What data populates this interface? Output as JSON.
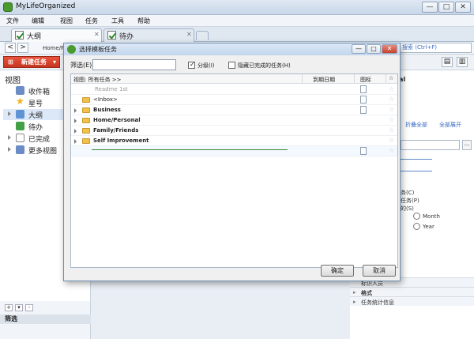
{
  "app": {
    "title": "MyLifeOrganized"
  },
  "window_buttons": {
    "minimize": "—",
    "maximize": "□",
    "close": "✕"
  },
  "menu": [
    "文件",
    "编辑",
    "视图",
    "任务",
    "工具",
    "帮助"
  ],
  "tabs": [
    {
      "label": "大纲"
    },
    {
      "label": "待办"
    }
  ],
  "nav": {
    "back": "<",
    "forward": ">",
    "breadcrumb": "Home/Pe",
    "search": "搜索 (Ctrl+F)"
  },
  "toolbar": {
    "new_task": "新建任务"
  },
  "sidebar": {
    "header": "视图",
    "items": [
      {
        "label": "收件箱",
        "icon": "inbox-icon",
        "color": "#6b8cc4"
      },
      {
        "label": "星号",
        "icon": "star-icon",
        "color": "#f2b21b"
      },
      {
        "label": "大纲",
        "icon": "outline-icon",
        "color": "#5f93d4"
      },
      {
        "label": "待办",
        "icon": "todo-icon",
        "color": "#43a047"
      },
      {
        "label": "已完成",
        "icon": "completed-icon",
        "color": "#888888"
      },
      {
        "label": "更多视图",
        "icon": "more-views-icon",
        "color": "#6b8cc4"
      }
    ],
    "bottom_add": "+",
    "bottom_options": "▾",
    "bottom_remove": "-",
    "filter": "筛选"
  },
  "dialog": {
    "title": "选择模板任务",
    "filter_label": "筛选(E)",
    "filter_value": "",
    "checkbox_hierarchy": "分级(I)",
    "checkbox_hierarchy_checked": true,
    "checkbox_hide_completed": "隐藏已完成的任务(H)",
    "checkbox_hide_completed_checked": false,
    "columns": {
      "view": "视图: 所有任务 >>",
      "due": "到期日期",
      "icon": "图标",
      "star": "☆"
    },
    "rows": [
      {
        "label": "Readme 1st",
        "bold": false,
        "grey": true,
        "expandable": false,
        "folder": false,
        "doc": true
      },
      {
        "label": "<Inbox>",
        "bold": false,
        "grey": false,
        "expandable": false,
        "folder": true,
        "doc": true
      },
      {
        "label": "Business",
        "bold": true,
        "grey": false,
        "expandable": true,
        "folder": true,
        "doc": true
      },
      {
        "label": "Home/Personal",
        "bold": true,
        "grey": false,
        "expandable": true,
        "folder": true,
        "doc": false
      },
      {
        "label": "Family/Friends",
        "bold": true,
        "grey": false,
        "expandable": true,
        "folder": true,
        "doc": false
      },
      {
        "label": "Self Improvement",
        "bold": true,
        "grey": false,
        "expandable": true,
        "folder": true,
        "doc": false
      }
    ],
    "ok": "确定",
    "cancel": "取消"
  },
  "right_panel": {
    "header": "al",
    "links": [
      "折叠全部",
      "全部展开"
    ],
    "options": [
      "务(C)",
      "任务(P)",
      "的(S)"
    ],
    "radio_month": "Month",
    "radio_year": "Year",
    "sections": [
      "标识人员",
      "格式",
      "任务统计信息"
    ]
  }
}
